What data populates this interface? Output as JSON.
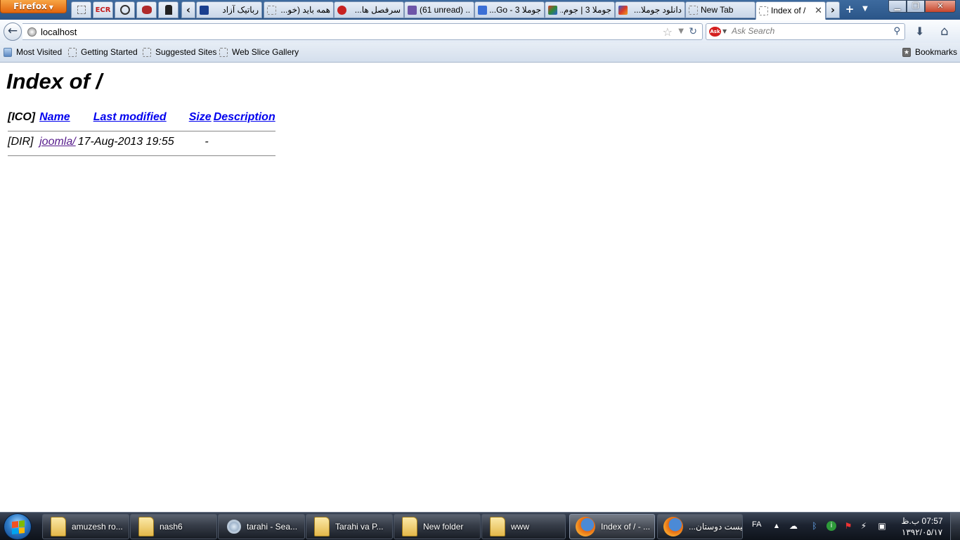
{
  "browser": {
    "menu_label": "Firefox",
    "app_tabs": [
      "",
      "ECR",
      "",
      "",
      ""
    ],
    "tabs": [
      {
        "label": "رباتیک آزاد",
        "favicon_color": "#1a3f8f"
      },
      {
        "label": "همه باید (خو...",
        "favicon_color": ""
      },
      {
        "label": "سرفصل ها...",
        "favicon_color": "#c72222"
      },
      {
        "label": "(61 unread) ...",
        "favicon_color": "#6d55a8"
      },
      {
        "label": "جوملا 3 - Go...",
        "favicon_color": "#3b6fd6"
      },
      {
        "label": "جوملا 3 | جوم...",
        "favicon_color": "#2c8a3a"
      },
      {
        "label": "دانلود جوملا...",
        "favicon_color": "#d83a2a"
      },
      {
        "label": "New Tab",
        "favicon_color": ""
      },
      {
        "label": "Index of /",
        "favicon_color": ""
      }
    ],
    "url": "localhost",
    "search_placeholder": "Ask Search",
    "search_engine_badge": "Ask",
    "bookmarks": [
      "Most Visited",
      "Getting Started",
      "Suggested Sites",
      "Web Slice Gallery"
    ],
    "bookmarks_menu": "Bookmarks"
  },
  "page": {
    "title": "Index of /",
    "columns": {
      "icon": "[ICO]",
      "name": "Name",
      "modified": "Last modified",
      "size": "Size",
      "description": "Description"
    },
    "rows": [
      {
        "icon": "[DIR]",
        "name": "joomla/",
        "modified": "17-Aug-2013 19:55",
        "size": "-",
        "description": ""
      }
    ]
  },
  "taskbar": {
    "items": [
      {
        "label": "amuzesh ro...",
        "icon": "folder-icon"
      },
      {
        "label": "nash6",
        "icon": "folder-icon"
      },
      {
        "label": "tarahi - Sea...",
        "icon": "search-icon"
      },
      {
        "label": "Tarahi va P...",
        "icon": "folder-icon"
      },
      {
        "label": "New folder",
        "icon": "folder-icon"
      },
      {
        "label": "www",
        "icon": "folder-icon"
      },
      {
        "label": "Index of / - ...",
        "icon": "firefox-icon"
      },
      {
        "label": "لیست دوستان...",
        "icon": "firefox-icon"
      }
    ],
    "language": "FA",
    "clock_time": "07:57 ب.ظ",
    "clock_date": "۱۳۹۲/۰۵/۱۷"
  }
}
